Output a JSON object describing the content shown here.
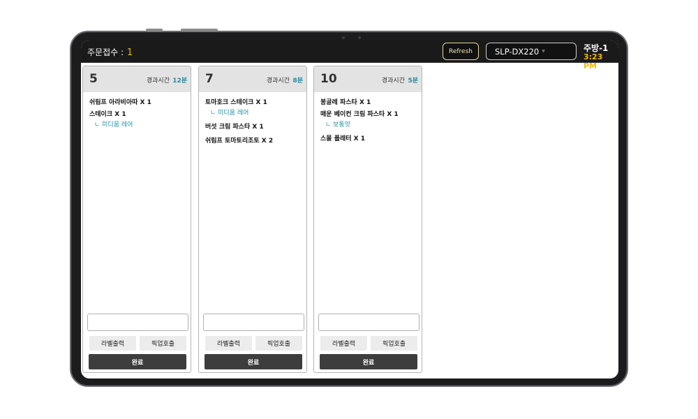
{
  "header": {
    "order_count_label": "주문접수 : ",
    "order_count": "1",
    "refresh_label": "Refresh",
    "printer": "SLP-DX220",
    "station": "주방-1",
    "time": "3:23 PM"
  },
  "orders": [
    {
      "table": "5",
      "elapsed_label": "경과시간",
      "elapsed": "12분",
      "items": [
        {
          "name": "쉬림프 아라비아따 X 1",
          "option": ""
        },
        {
          "name": "스테이크 X 1",
          "option": "ㄴ 미디움 레어"
        }
      ],
      "label_btn": "라벨출력",
      "pickup_btn": "픽업호출",
      "done_btn": "완료"
    },
    {
      "table": "7",
      "elapsed_label": "경과시간",
      "elapsed": "8분",
      "items": [
        {
          "name": "토마호크 스테이크 X 1",
          "option": "ㄴ 미디움 레어"
        },
        {
          "name": "버섯 크림 파스타 X 1",
          "option": ""
        },
        {
          "name": "쉬림프 토마토리조토 X 2",
          "option": ""
        }
      ],
      "label_btn": "라벨출력",
      "pickup_btn": "픽업호출",
      "done_btn": "완료"
    },
    {
      "table": "10",
      "elapsed_label": "경과시간",
      "elapsed": "5분",
      "items": [
        {
          "name": "봉골레 파스타 X 1",
          "option": ""
        },
        {
          "name": "매운 베이컨 크림 파스타 X 1",
          "option": "ㄴ 보통맛"
        },
        {
          "name": "스몰 플래터 X 1",
          "option": ""
        }
      ],
      "label_btn": "라벨출력",
      "pickup_btn": "픽업호출",
      "done_btn": "완료"
    }
  ],
  "colors": {
    "accent_yellow": "#f5b800",
    "accent_teal": "#1e8fa0",
    "topbar": "#1a1a1a",
    "done_button": "#3d3d3d"
  }
}
